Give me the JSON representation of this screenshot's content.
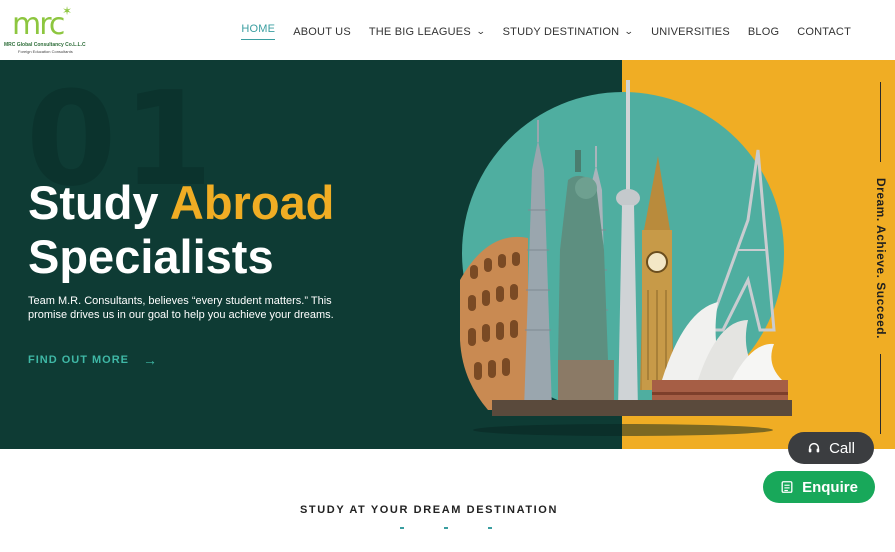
{
  "header": {
    "logo": {
      "mark": "mrc",
      "name": "MRC Global Consultancy Co.L.L.C",
      "tagline": "Foreign Education Consultants"
    },
    "nav": [
      {
        "label": "HOME",
        "active": true,
        "dropdown": false
      },
      {
        "label": "ABOUT US",
        "active": false,
        "dropdown": false
      },
      {
        "label": "THE BIG LEAGUES",
        "active": false,
        "dropdown": true
      },
      {
        "label": "STUDY DESTINATION",
        "active": false,
        "dropdown": true
      },
      {
        "label": "UNIVERSITIES",
        "active": false,
        "dropdown": false
      },
      {
        "label": "BLOG",
        "active": false,
        "dropdown": false
      },
      {
        "label": "CONTACT",
        "active": false,
        "dropdown": false
      }
    ]
  },
  "hero": {
    "bg_number": "01",
    "title_word1": "Study",
    "title_accent": "Abroad",
    "title_line2": "Specialists",
    "description": "Team M.R. Consultants, believes “every student matters.” This promise drives us in our goal to help you achieve your dreams.",
    "cta_label": "FIND OUT MORE",
    "cta_icon": "arrow-right-icon",
    "side_tagline": "Dream. Achieve. Succeed.",
    "colors": {
      "dark": "#0e3b34",
      "gold": "#f0ad24",
      "teal": "#4faea0",
      "accent_text": "#3fb8a6"
    }
  },
  "floating": {
    "call_label": "Call",
    "call_icon": "headset-icon",
    "enquire_label": "Enquire",
    "enquire_icon": "form-icon"
  },
  "section": {
    "title": "STUDY AT YOUR DREAM DESTINATION"
  }
}
